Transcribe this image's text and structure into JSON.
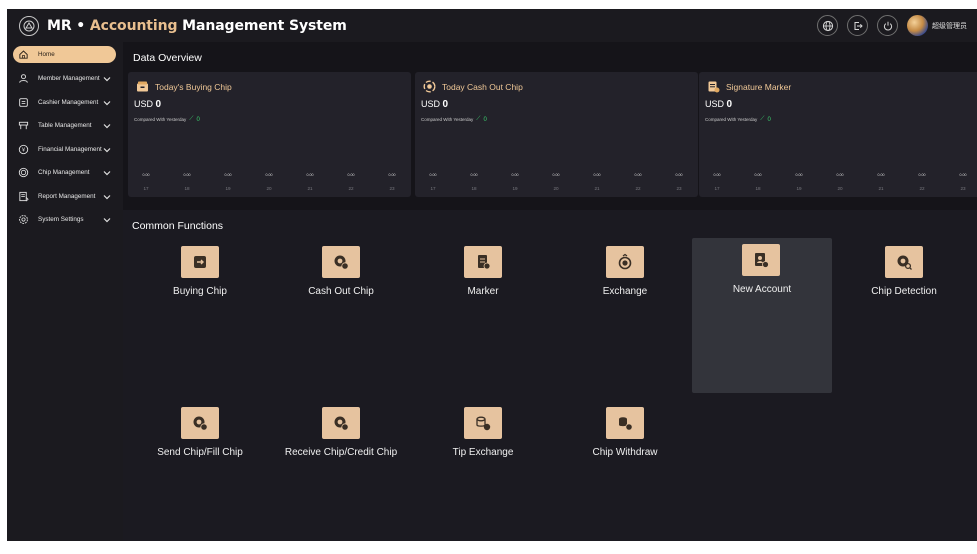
{
  "header": {
    "title_prefix": "MR • ",
    "title_accent": "Accounting",
    "title_rest": " Management System",
    "username": "超级管理员",
    "icons": [
      "globe-icon",
      "logout-icon",
      "power-icon"
    ]
  },
  "sidebar": {
    "items": [
      {
        "label": "Home",
        "icon": "home-icon",
        "active": true,
        "has_children": false
      },
      {
        "label": "Member Management",
        "icon": "users-icon",
        "active": false,
        "has_children": true
      },
      {
        "label": "Cashier Management",
        "icon": "cashier-icon",
        "active": false,
        "has_children": true
      },
      {
        "label": "Table Management",
        "icon": "table-icon",
        "active": false,
        "has_children": true
      },
      {
        "label": "Financial Management",
        "icon": "finance-icon",
        "active": false,
        "has_children": true
      },
      {
        "label": "Chip Management",
        "icon": "chip-icon",
        "active": false,
        "has_children": true
      },
      {
        "label": "Report Management",
        "icon": "report-icon",
        "active": false,
        "has_children": true
      },
      {
        "label": "System Settings",
        "icon": "settings-icon",
        "active": false,
        "has_children": true
      }
    ]
  },
  "overview": {
    "title": "Data Overview",
    "cards": [
      {
        "title": "Today's Buying Chip",
        "icon": "wallet-icon",
        "currency": "USD",
        "value": "0",
        "compare_label": "Compared With Yesterday",
        "compare_value": "0",
        "y_labels": [
          "0.00",
          "0.00",
          "0.00",
          "0.00",
          "0.00",
          "0.00",
          "0.00"
        ],
        "x_labels": [
          "17",
          "18",
          "19",
          "20",
          "21",
          "22",
          "23"
        ]
      },
      {
        "title": "Today Cash Out Chip",
        "icon": "cashout-icon",
        "currency": "USD",
        "value": "0",
        "compare_label": "Compared With Yesterday",
        "compare_value": "0",
        "y_labels": [
          "0.00",
          "0.00",
          "0.00",
          "0.00",
          "0.00",
          "0.00",
          "0.00"
        ],
        "x_labels": [
          "17",
          "18",
          "19",
          "20",
          "21",
          "22",
          "23"
        ]
      },
      {
        "title": "Signature Marker",
        "icon": "marker-icon",
        "currency": "USD",
        "value": "0",
        "compare_label": "Compared With Yesterday",
        "compare_value": "0",
        "y_labels": [
          "0.00",
          "0.00",
          "0.00",
          "0.00",
          "0.00",
          "0.00",
          "0.00"
        ],
        "x_labels": [
          "17",
          "18",
          "19",
          "20",
          "21",
          "22",
          "23"
        ]
      }
    ]
  },
  "functions": {
    "title": "Common Functions",
    "items": [
      {
        "label": "Buying Chip",
        "icon": "buy-chip-icon"
      },
      {
        "label": "Cash Out Chip",
        "icon": "cash-out-chip-icon"
      },
      {
        "label": "Marker",
        "icon": "marker-doc-icon"
      },
      {
        "label": "Exchange",
        "icon": "exchange-icon"
      },
      {
        "label": "New Account",
        "icon": "new-account-icon",
        "highlighted": true
      },
      {
        "label": "Chip Detection",
        "icon": "chip-detection-icon"
      },
      {
        "label": "Send Chip/Fill Chip",
        "icon": "send-chip-icon"
      },
      {
        "label": "Receive Chip/Credit Chip",
        "icon": "receive-chip-icon"
      },
      {
        "label": "Tip Exchange",
        "icon": "tip-exchange-icon"
      },
      {
        "label": "Chip Withdraw",
        "icon": "chip-withdraw-icon"
      }
    ]
  },
  "colors": {
    "accent": "#f0c897",
    "tile_icon_bg": "#e6c39f",
    "trend_green": "#3bd16f",
    "background": "#151419",
    "panel": "#23222a"
  }
}
